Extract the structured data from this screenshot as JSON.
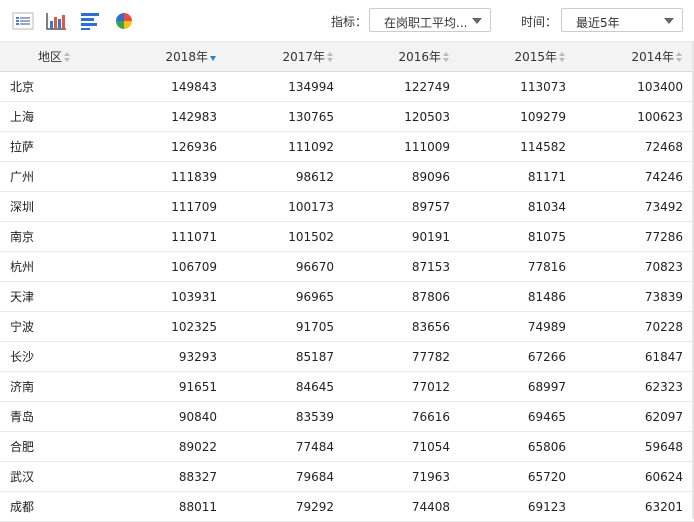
{
  "toolbar": {
    "icons": [
      "list-view-icon",
      "bar-chart-icon",
      "horizontal-bar-icon",
      "pie-chart-icon"
    ],
    "indicator_label": "指标：",
    "indicator_value": "在岗职工平均...",
    "time_label": "时间：",
    "time_value": "最近5年",
    "pie_colors": [
      "#e94b3c",
      "#f4c21b",
      "#3aa34a",
      "#2f6fd0"
    ]
  },
  "table": {
    "headers": [
      "地区",
      "2018年",
      "2017年",
      "2016年",
      "2015年",
      "2014年"
    ],
    "sorted_column": "2018年",
    "rows": [
      [
        "北京",
        "149843",
        "134994",
        "122749",
        "113073",
        "103400"
      ],
      [
        "上海",
        "142983",
        "130765",
        "120503",
        "109279",
        "100623"
      ],
      [
        "拉萨",
        "126936",
        "111092",
        "111009",
        "114582",
        "72468"
      ],
      [
        "广州",
        "111839",
        "98612",
        "89096",
        "81171",
        "74246"
      ],
      [
        "深圳",
        "111709",
        "100173",
        "89757",
        "81034",
        "73492"
      ],
      [
        "南京",
        "111071",
        "101502",
        "90191",
        "81075",
        "77286"
      ],
      [
        "杭州",
        "106709",
        "96670",
        "87153",
        "77816",
        "70823"
      ],
      [
        "天津",
        "103931",
        "96965",
        "87806",
        "81486",
        "73839"
      ],
      [
        "宁波",
        "102325",
        "91705",
        "83656",
        "74989",
        "70228"
      ],
      [
        "长沙",
        "93293",
        "85187",
        "77782",
        "67266",
        "61847"
      ],
      [
        "济南",
        "91651",
        "84645",
        "77012",
        "68997",
        "62323"
      ],
      [
        "青岛",
        "90840",
        "83539",
        "76616",
        "69465",
        "62097"
      ],
      [
        "合肥",
        "89022",
        "77484",
        "71054",
        "65806",
        "59648"
      ],
      [
        "武汉",
        "88327",
        "79684",
        "71963",
        "65720",
        "60624"
      ],
      [
        "成都",
        "88011",
        "79292",
        "74408",
        "69123",
        "63201"
      ]
    ]
  }
}
